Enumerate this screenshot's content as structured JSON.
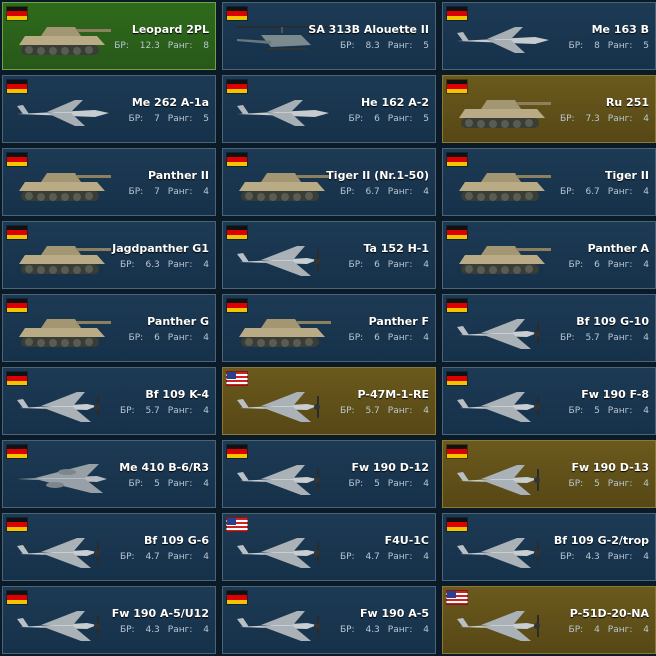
{
  "labels": {
    "br": "БР:",
    "rank": "Ранг:"
  },
  "colors": {
    "standard": "#1d3a54",
    "premium": "#6b5a1c",
    "squadron": "#2f6b1b"
  },
  "vehicles": [
    {
      "name": "Leopard 2PL",
      "br": "12.3",
      "rank": "8",
      "nation": "germany",
      "type": "tank",
      "tier": "squadron"
    },
    {
      "name": "SA 313B Alouette II",
      "br": "8.3",
      "rank": "5",
      "nation": "germany",
      "type": "heli",
      "tier": "standard"
    },
    {
      "name": "Me 163 B",
      "br": "8",
      "rank": "5",
      "nation": "germany",
      "type": "jet",
      "tier": "standard"
    },
    {
      "name": "Me 262 A-1a",
      "br": "7",
      "rank": "5",
      "nation": "germany",
      "type": "jet",
      "tier": "standard"
    },
    {
      "name": "He 162 A-2",
      "br": "6",
      "rank": "5",
      "nation": "germany",
      "type": "jet",
      "tier": "standard"
    },
    {
      "name": "Ru 251",
      "br": "7.3",
      "rank": "4",
      "nation": "germany",
      "type": "tank",
      "tier": "premium"
    },
    {
      "name": "Panther II",
      "br": "7",
      "rank": "4",
      "nation": "germany",
      "type": "tank",
      "tier": "standard"
    },
    {
      "name": "Tiger II (Nr.1-50)",
      "br": "6.7",
      "rank": "4",
      "nation": "germany",
      "type": "tank",
      "tier": "standard"
    },
    {
      "name": "Tiger II",
      "br": "6.7",
      "rank": "4",
      "nation": "germany",
      "type": "tank",
      "tier": "standard"
    },
    {
      "name": "Jagdpanther G1",
      "br": "6.3",
      "rank": "4",
      "nation": "germany",
      "type": "tank",
      "tier": "standard"
    },
    {
      "name": "Ta 152 H-1",
      "br": "6",
      "rank": "4",
      "nation": "germany",
      "type": "prop",
      "tier": "standard"
    },
    {
      "name": "Panther A",
      "br": "6",
      "rank": "4",
      "nation": "germany",
      "type": "tank",
      "tier": "standard"
    },
    {
      "name": "Panther G",
      "br": "6",
      "rank": "4",
      "nation": "germany",
      "type": "tank",
      "tier": "standard"
    },
    {
      "name": "Panther F",
      "br": "6",
      "rank": "4",
      "nation": "germany",
      "type": "tank",
      "tier": "standard"
    },
    {
      "name": "Bf 109 G-10",
      "br": "5.7",
      "rank": "4",
      "nation": "germany",
      "type": "prop",
      "tier": "standard"
    },
    {
      "name": "Bf 109 K-4",
      "br": "5.7",
      "rank": "4",
      "nation": "germany",
      "type": "prop",
      "tier": "standard"
    },
    {
      "name": "P-47M-1-RE",
      "br": "5.7",
      "rank": "4",
      "nation": "usa",
      "type": "prop",
      "tier": "premium"
    },
    {
      "name": "Fw 190 F-8",
      "br": "5",
      "rank": "4",
      "nation": "germany",
      "type": "prop",
      "tier": "standard"
    },
    {
      "name": "Me 410 B-6/R3",
      "br": "5",
      "rank": "4",
      "nation": "germany",
      "type": "twin",
      "tier": "standard"
    },
    {
      "name": "Fw 190 D-12",
      "br": "5",
      "rank": "4",
      "nation": "germany",
      "type": "prop",
      "tier": "standard"
    },
    {
      "name": "Fw 190 D-13",
      "br": "5",
      "rank": "4",
      "nation": "germany",
      "type": "prop",
      "tier": "premium"
    },
    {
      "name": "Bf 109 G-6",
      "br": "4.7",
      "rank": "4",
      "nation": "germany",
      "type": "prop",
      "tier": "standard"
    },
    {
      "name": "F4U-1C",
      "br": "4.7",
      "rank": "4",
      "nation": "usa",
      "type": "prop",
      "tier": "standard"
    },
    {
      "name": "Bf 109 G-2/trop",
      "br": "4.3",
      "rank": "4",
      "nation": "germany",
      "type": "prop",
      "tier": "standard"
    },
    {
      "name": "Fw 190 A-5/U12",
      "br": "4.3",
      "rank": "4",
      "nation": "germany",
      "type": "prop",
      "tier": "standard"
    },
    {
      "name": "Fw 190 A-5",
      "br": "4.3",
      "rank": "4",
      "nation": "germany",
      "type": "prop",
      "tier": "standard"
    },
    {
      "name": "P-51D-20-NA",
      "br": "4",
      "rank": "4",
      "nation": "usa",
      "type": "prop",
      "tier": "premium"
    }
  ]
}
